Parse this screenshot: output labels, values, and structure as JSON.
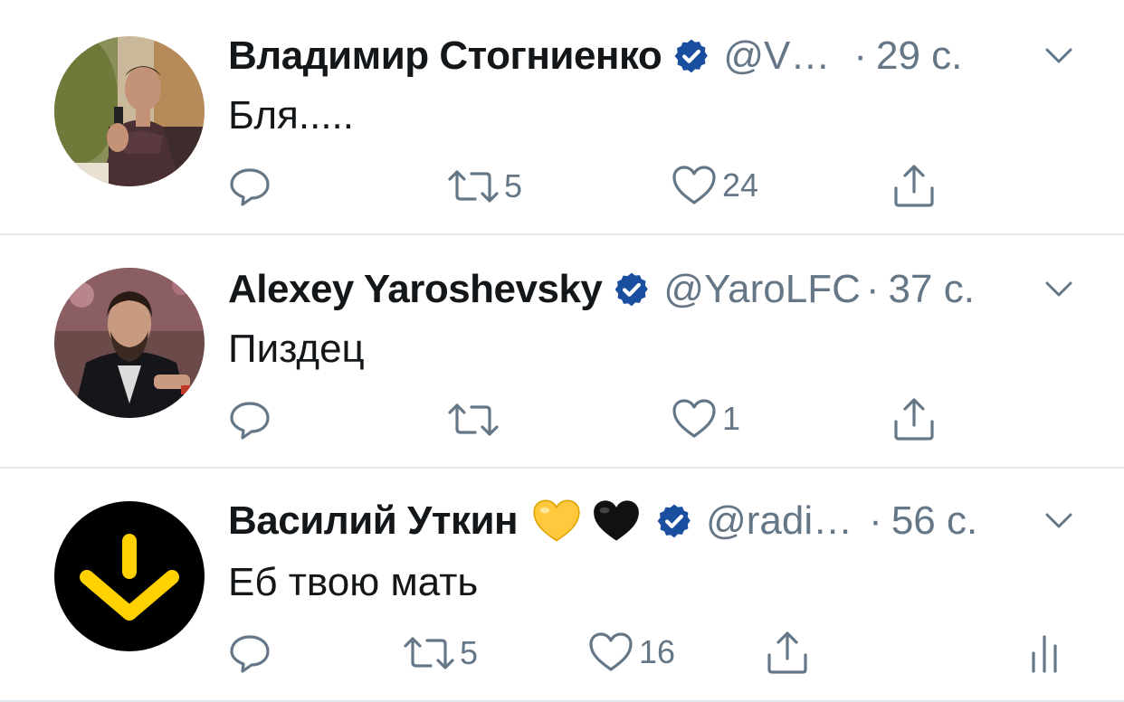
{
  "tweets": [
    {
      "name": "Владимир Стогниенко",
      "handle": "@V…",
      "time": "29 с.",
      "text": "Бля.....",
      "retweets": "5",
      "likes": "24",
      "avatar_icon": "person-with-microphone-avatar"
    },
    {
      "name": "Alexey Yaroshevsky",
      "handle": "@YaroLFC",
      "time": "37 с.",
      "text": "Пиздец",
      "retweets": "",
      "likes": "1",
      "avatar_icon": "bearded-man-avatar"
    },
    {
      "name": "Василий Уткин",
      "handle": "@radi…",
      "time": "56 с.",
      "text": "Еб твою мать",
      "retweets": "5",
      "likes": "16",
      "emojis": [
        "yellow-heart-emoji",
        "black-heart-emoji"
      ],
      "avatar_icon": "yellow-logo-avatar"
    }
  ],
  "separator": "·",
  "colors": {
    "verified_blue": "#1da1f2",
    "verified_badge": "#1a4fa0",
    "secondary_text": "#657786",
    "divider": "#e1e8ed",
    "logo_yellow": "#ffd100"
  }
}
